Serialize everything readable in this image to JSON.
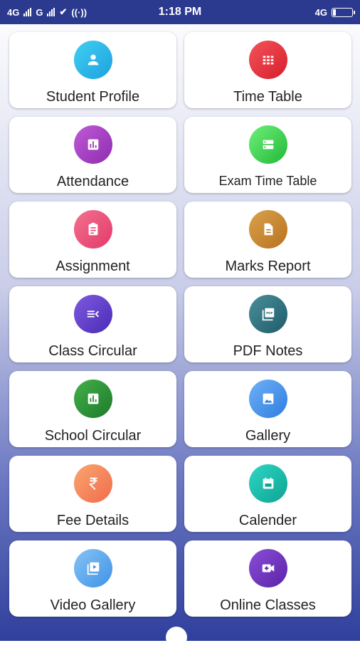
{
  "status_bar": {
    "left_network_1": "4G",
    "left_network_2": "G",
    "time": "1:18 PM",
    "right_network": "4G"
  },
  "menu": [
    {
      "label": "Student Profile",
      "icon": "person-icon",
      "color_from": "#3fd0f0",
      "color_to": "#1ea1e0"
    },
    {
      "label": "Time Table",
      "icon": "grid-icon",
      "color_from": "#f2545b",
      "color_to": "#d81e2b"
    },
    {
      "label": "Attendance",
      "icon": "bar-chart-icon",
      "color_from": "#c05ad6",
      "color_to": "#8e2db0"
    },
    {
      "label": "Exam Time Table",
      "icon": "storage-icon",
      "color_from": "#6ef07a",
      "color_to": "#22b838"
    },
    {
      "label": "Assignment",
      "icon": "clipboard-icon",
      "color_from": "#f2718f",
      "color_to": "#e33a6a"
    },
    {
      "label": "Marks Report",
      "icon": "document-icon",
      "color_from": "#d9a24a",
      "color_to": "#b87220"
    },
    {
      "label": "Class Circular",
      "icon": "list-icon",
      "color_from": "#7e5be0",
      "color_to": "#4a2bb5"
    },
    {
      "label": "PDF Notes",
      "icon": "pdf-icon",
      "color_from": "#4a8f99",
      "color_to": "#1f5b6b"
    },
    {
      "label": "School Circular",
      "icon": "bar-chart-icon",
      "color_from": "#43b04a",
      "color_to": "#1e7a2a"
    },
    {
      "label": "Gallery",
      "icon": "image-icon",
      "color_from": "#6fb1f7",
      "color_to": "#2f7de0"
    },
    {
      "label": "Fee Details",
      "icon": "rupee-icon",
      "color_from": "#f9a66e",
      "color_to": "#f26b4d"
    },
    {
      "label": "Calender",
      "icon": "calendar-icon",
      "color_from": "#2ed6c5",
      "color_to": "#0fa392"
    },
    {
      "label": "Video Gallery",
      "icon": "video-library-icon",
      "color_from": "#86c4f5",
      "color_to": "#3f92e6"
    },
    {
      "label": "Online Classes",
      "icon": "video-call-icon",
      "color_from": "#8a4ed6",
      "color_to": "#5a23a8"
    }
  ]
}
